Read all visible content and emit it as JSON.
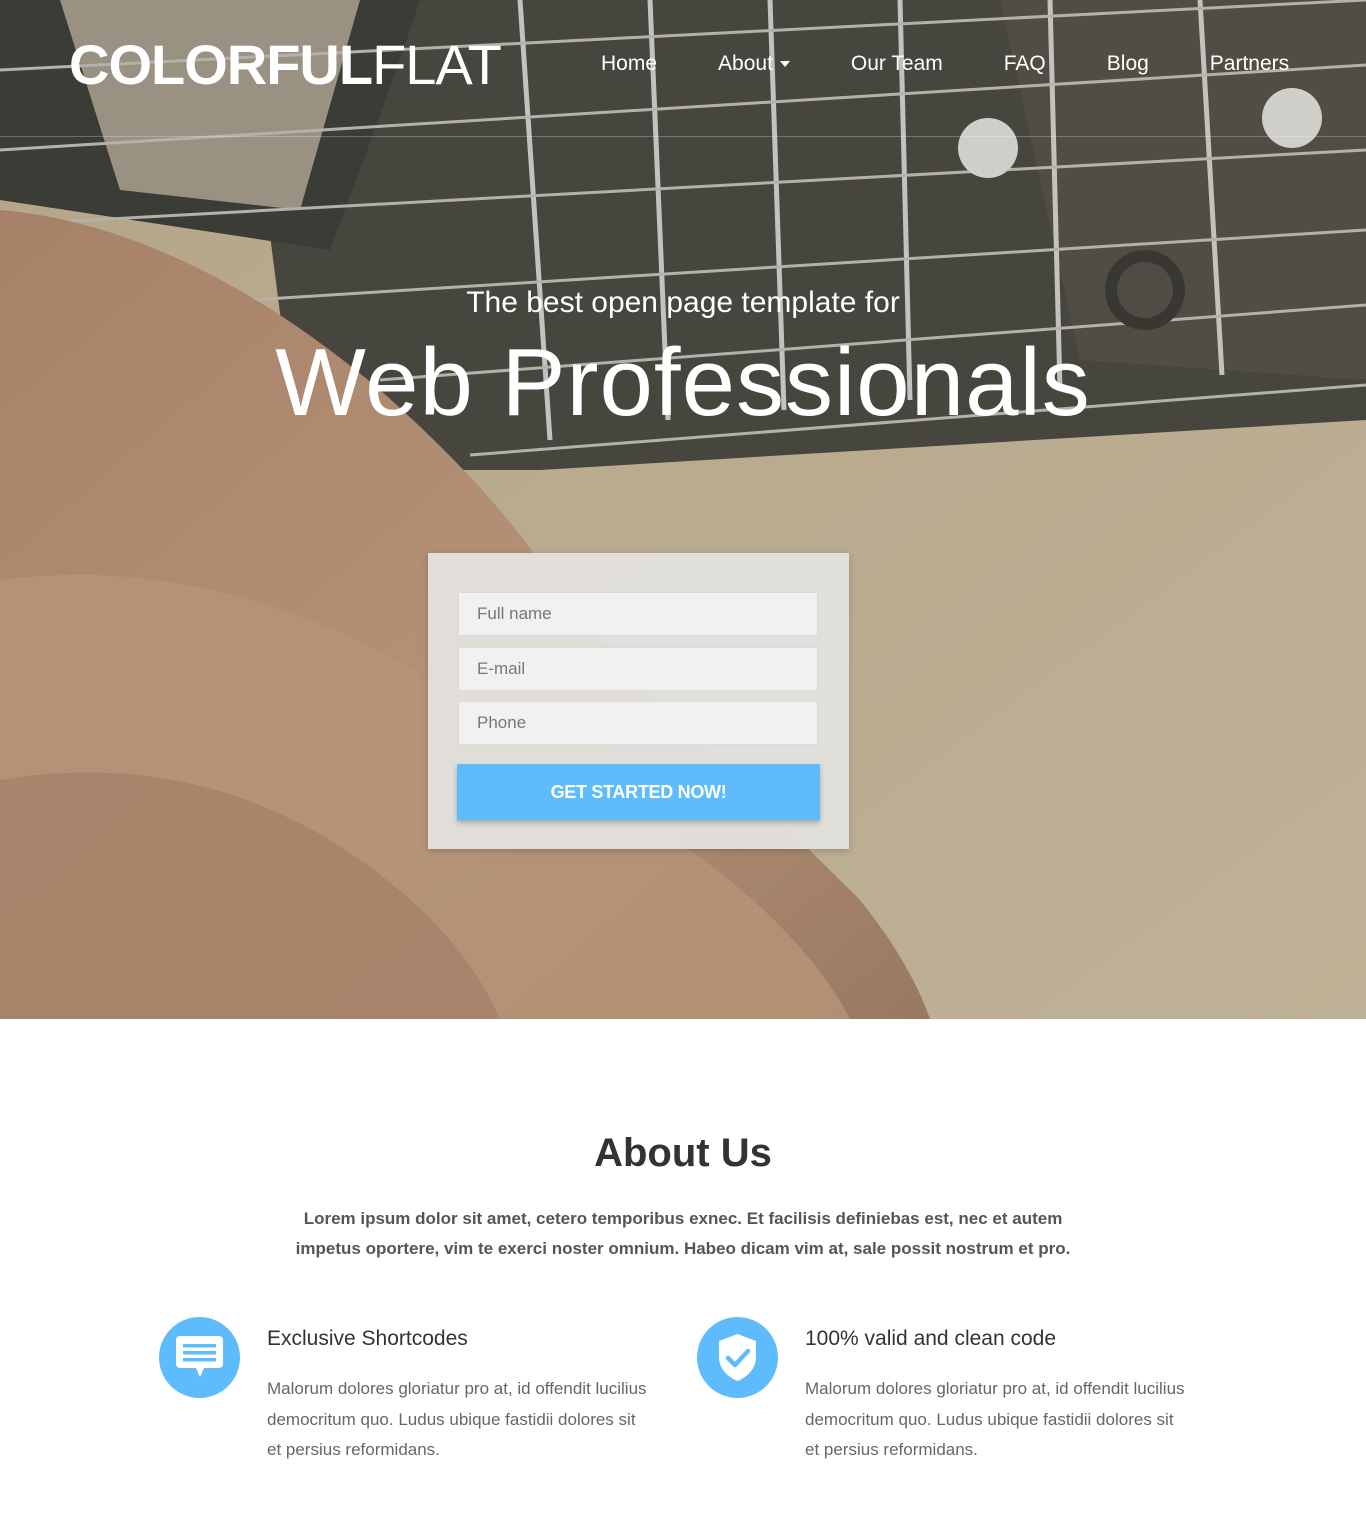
{
  "brand": {
    "bold": "COLORFUL",
    "light": "FLAT"
  },
  "nav": {
    "items": [
      {
        "label": "Home"
      },
      {
        "label": "About"
      },
      {
        "label": "Our Team"
      },
      {
        "label": "FAQ"
      },
      {
        "label": "Blog"
      },
      {
        "label": "Partners"
      }
    ]
  },
  "hero": {
    "tagline": "The best open page template for",
    "headline": "Web Professionals"
  },
  "signup_form": {
    "full_name_placeholder": "Full name",
    "email_placeholder": "E-mail",
    "phone_placeholder": "Phone",
    "submit_label": "GET STARTED NOW!"
  },
  "about": {
    "title": "About Us",
    "lead": "Lorem ipsum dolor sit amet, cetero temporibus exnec. Et facilisis definiebas est, nec et autem impetus oportere, vim te exerci noster omnium. Habeo dicam vim at, sale possit nostrum et pro.",
    "features": [
      {
        "icon": "chat-bubble-icon",
        "title": "Exclusive Shortcodes",
        "text": "Malorum dolores gloriatur pro at, id offendit lucilius democritum quo. Ludus ubique fastidii dolores sit et persius reformidans."
      },
      {
        "icon": "shield-check-icon",
        "title": "100% valid and clean code",
        "text": "Malorum dolores gloriatur pro at, id offendit lucilius democritum quo. Ludus ubique fastidii dolores sit et persius reformidans."
      }
    ]
  },
  "colors": {
    "accent": "#5ebcfc",
    "heading": "#333333",
    "body_text": "#666666"
  }
}
